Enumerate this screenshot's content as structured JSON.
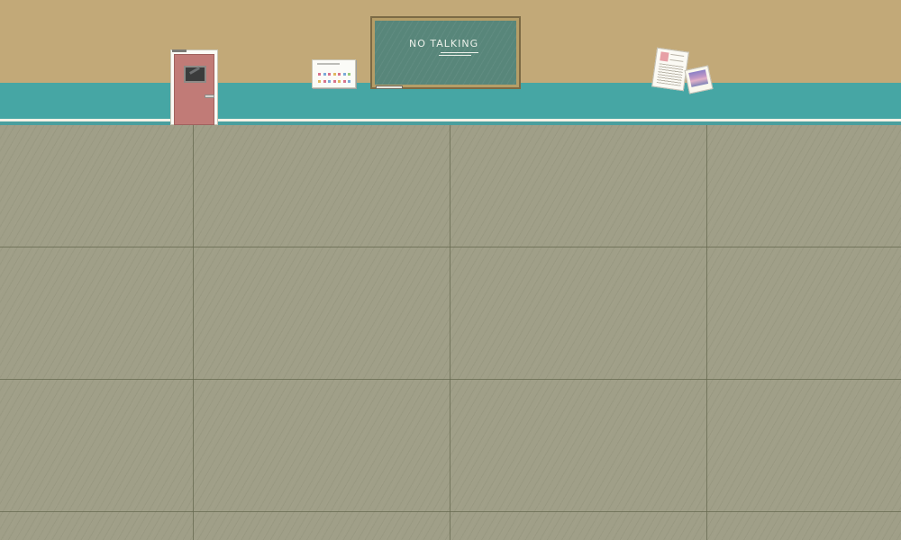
{
  "scene": {
    "type": "classroom-hallway",
    "colors": {
      "wall": "#c2a978",
      "wall_stripe": "#46a6a4",
      "floor": "#a09f88",
      "door": "#c17b77",
      "chalkboard": "#58867a"
    }
  },
  "chalkboard": {
    "text": "NO TALKING"
  },
  "calendar": {
    "dot_colors": [
      "#d9738c",
      "#7aa8d8",
      "#d9738c",
      "#e0b860",
      "#d9738c",
      "#7aa8d8",
      "#9acb7a",
      "#e0b860",
      "#d9738c",
      "#7aa8d8",
      "#d9738c",
      "#e0b860",
      "#d9738c",
      "#7aa8d8"
    ]
  },
  "icons": {
    "door": "door-icon",
    "calendar": "calendar-icon",
    "chalkboard": "chalkboard-icon",
    "note": "paper-note-icon",
    "photo": "photo-icon"
  }
}
